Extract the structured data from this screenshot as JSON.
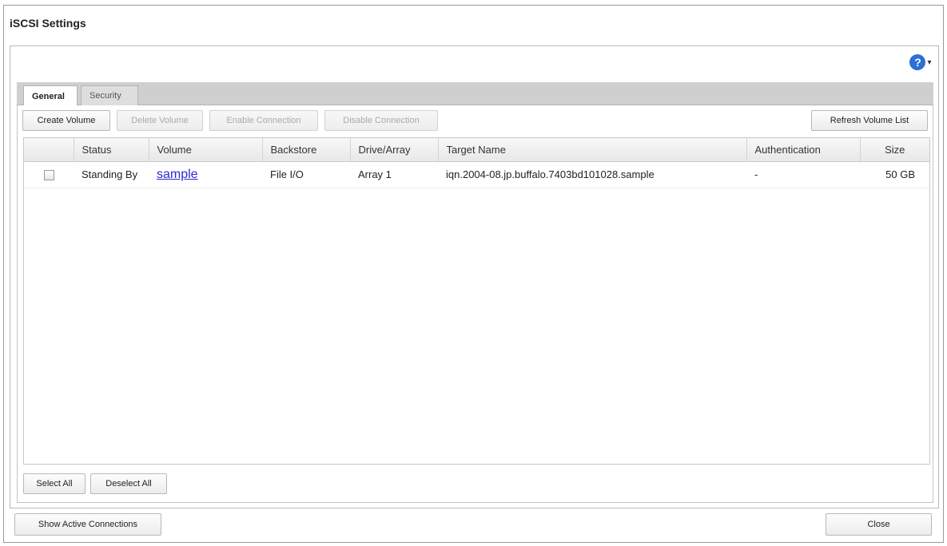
{
  "window": {
    "title": "iSCSI Settings"
  },
  "help": {
    "icon": "help-circle-icon",
    "symbol": "?",
    "caret": "▾"
  },
  "tabs": [
    {
      "label": "General",
      "active": true
    },
    {
      "label": "Security",
      "active": false
    }
  ],
  "toolbar": {
    "create_volume": "Create Volume",
    "delete_volume": "Delete Volume",
    "enable_connection": "Enable Connection",
    "disable_connection": "Disable Connection",
    "refresh_volume_list": "Refresh Volume List"
  },
  "table": {
    "columns": [
      "",
      "Status",
      "Volume",
      "Backstore",
      "Drive/Array",
      "Target Name",
      "Authentication",
      "Size"
    ],
    "rows": [
      {
        "status": "Standing By",
        "volume": "sample",
        "backstore": "File I/O",
        "drive_array": "Array 1",
        "target_name": "iqn.2004-08.jp.buffalo.7403bd101028.sample",
        "authentication": "-",
        "size": "50 GB"
      }
    ]
  },
  "selection": {
    "select_all": "Select All",
    "deselect_all": "Deselect All"
  },
  "footer": {
    "show_active_connections": "Show Active Connections",
    "close": "Close"
  }
}
